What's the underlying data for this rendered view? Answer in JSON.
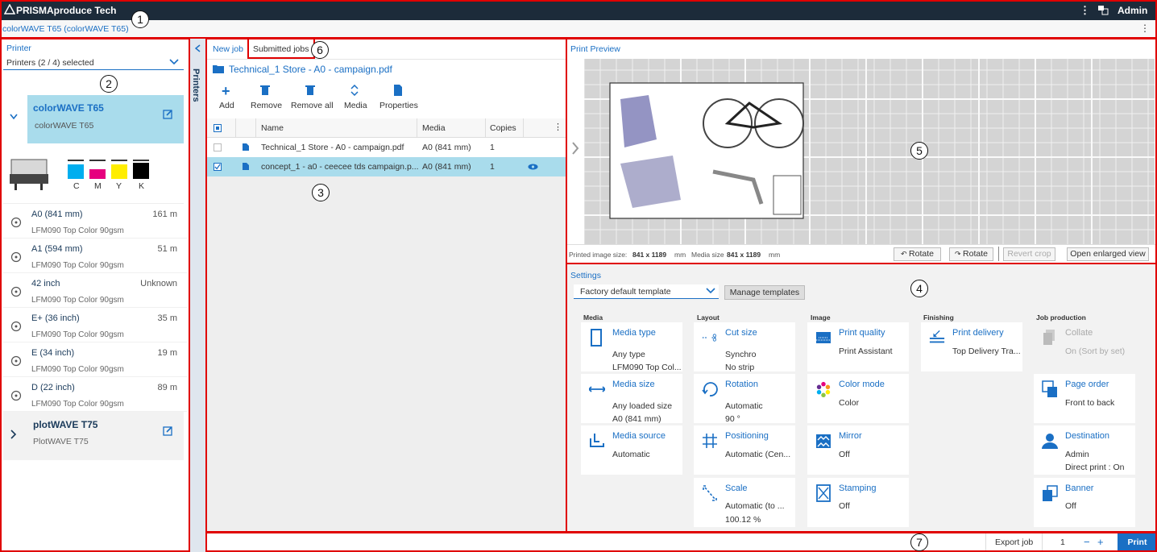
{
  "app": {
    "title": "PRISMAproduce Tech",
    "user": "Admin",
    "device_title": "colorWAVE T65 (colorWAVE T65)"
  },
  "left": {
    "header": "Printer",
    "selector": "Printers (2 / 4) selected",
    "vtab": "Printers",
    "printer1": {
      "name": "colorWAVE T65",
      "model": "colorWAVE T65"
    },
    "inks": [
      "C",
      "M",
      "Y",
      "K"
    ],
    "inkColors": [
      "#00aeef",
      "#e6007e",
      "#ffed00",
      "#000000"
    ],
    "media": [
      {
        "name": "A0 (841 mm)",
        "remaining": "161 m",
        "type": "LFM090 Top Color 90gsm"
      },
      {
        "name": "A1 (594 mm)",
        "remaining": "51 m",
        "type": "LFM090 Top Color 90gsm"
      },
      {
        "name": "42 inch",
        "remaining": "Unknown",
        "type": "LFM090 Top Color 90gsm"
      },
      {
        "name": "E+ (36 inch)",
        "remaining": "35 m",
        "type": "LFM090 Top Color 90gsm"
      },
      {
        "name": "E (34 inch)",
        "remaining": "19 m",
        "type": "LFM090 Top Color 90gsm"
      },
      {
        "name": "D (22 inch)",
        "remaining": "89 m",
        "type": "LFM090 Top Color 90gsm"
      }
    ],
    "printer2": {
      "name": "plotWAVE T75",
      "model": "PlotWAVE T75"
    }
  },
  "jobs": {
    "tabs": [
      "New job",
      "Submitted jobs"
    ],
    "folder": "Technical_1 Store - A0 - campaign.pdf",
    "toolbar": [
      "Add",
      "Remove",
      "Remove all",
      "Media",
      "Properties"
    ],
    "headers": [
      "Name",
      "Media",
      "Copies"
    ],
    "rows": [
      {
        "name": "Technical_1 Store - A0 - campaign.pdf",
        "media": "A0 (841 mm)",
        "copies": "1"
      },
      {
        "name": "concept_1 - a0 - ceecee tds campaign.p...",
        "media": "A0 (841 mm)",
        "copies": "1"
      }
    ]
  },
  "preview": {
    "title": "Print Preview",
    "info_label1": "Printed image size:",
    "info_value1": "841 x 1189",
    "info_unit1": "mm",
    "info_label2": "Media size",
    "info_value2": "841 x 1189",
    "info_unit2": "mm",
    "rotate1": "Rotate",
    "rotate2": "Rotate",
    "revert": "Revert crop",
    "enlarge": "Open enlarged view"
  },
  "settings": {
    "title": "Settings",
    "template": "Factory default template",
    "manage": "Manage templates",
    "groups": [
      "Media",
      "Layout",
      "Image",
      "Finishing",
      "Job production"
    ],
    "media_type": {
      "t": "Media type",
      "v1": "Any type",
      "v2": "LFM090 Top Col..."
    },
    "media_size": {
      "t": "Media size",
      "v1": "Any loaded size",
      "v2": "A0 (841 mm)"
    },
    "media_source": {
      "t": "Media source",
      "v1": "Automatic"
    },
    "cut_size": {
      "t": "Cut size",
      "v1": "Synchro",
      "v2": "No strip"
    },
    "rotation": {
      "t": "Rotation",
      "v1": "Automatic",
      "v2": "90 °"
    },
    "positioning": {
      "t": "Positioning",
      "v1": "Automatic (Cen..."
    },
    "scale": {
      "t": "Scale",
      "v1": "Automatic (to ...",
      "v2": "100.12 %"
    },
    "print_quality": {
      "t": "Print quality",
      "v1": "Print Assistant"
    },
    "color_mode": {
      "t": "Color mode",
      "v1": "Color"
    },
    "mirror": {
      "t": "Mirror",
      "v1": "Off"
    },
    "stamping": {
      "t": "Stamping",
      "v1": "Off"
    },
    "print_delivery": {
      "t": "Print delivery",
      "v1": "Top Delivery Tra..."
    },
    "collate": {
      "t": "Collate",
      "v1": "On (Sort by set)"
    },
    "page_order": {
      "t": "Page order",
      "v1": "Front to back"
    },
    "destination": {
      "t": "Destination",
      "v1": "Admin",
      "v2": "Direct print : On"
    },
    "banner": {
      "t": "Banner",
      "v1": "Off"
    }
  },
  "bottom": {
    "export": "Export job",
    "copies": "1",
    "minus": "−",
    "plus": "+",
    "print": "Print"
  },
  "callouts": [
    "1",
    "2",
    "3",
    "4",
    "5",
    "6",
    "7"
  ]
}
